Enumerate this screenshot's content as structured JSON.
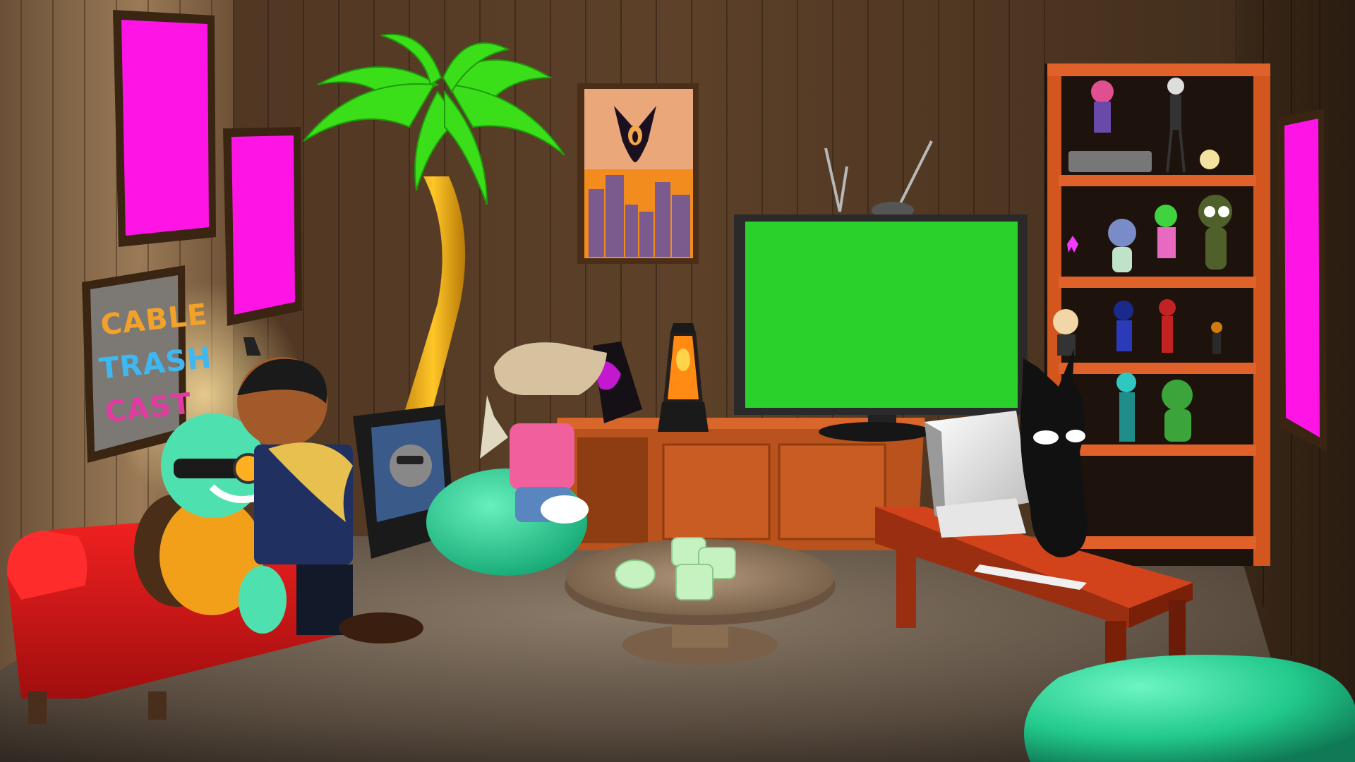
{
  "scene": {
    "description_colors": {
      "wall_wood": "#5a3d24",
      "wall_left": "#8a6a48",
      "floor": "#5e5145",
      "couch": "#d81818",
      "screen_green": "#2ad12a",
      "magenta": "#ff14e6",
      "shelf_orange": "#c2511b",
      "beanbag_teal": "#2ad698",
      "palm_trunk": "#f2b21a",
      "palm_leaves": "#3adf1a"
    }
  },
  "poster": {
    "line1": "CABLE",
    "line2": "TRASH",
    "line3": "CAST"
  },
  "icons": {
    "tv": "tv-icon",
    "computer": "computer-icon",
    "lava_lamp": "lava-lamp-icon"
  }
}
